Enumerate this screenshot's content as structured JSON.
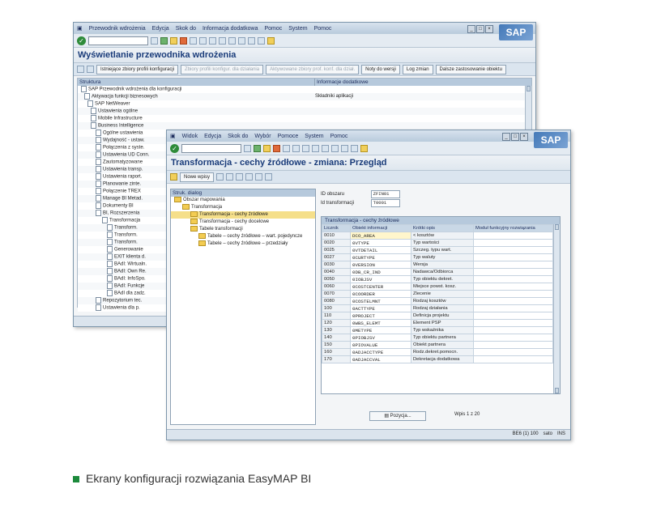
{
  "win1": {
    "menu": [
      "Przewodnik wdrożenia",
      "Edycja",
      "Skok do",
      "Informacja dodatkowa",
      "Pomoc",
      "System",
      "Pomoc"
    ],
    "title": "Wyświetlanie przewodnika wdrożenia",
    "buttons": [
      {
        "label": "Istniejące zbiory profili konfiguracji",
        "enabled": true
      },
      {
        "label": "Zbiory profili konfigur. dla działania",
        "enabled": false
      },
      {
        "label": "Aktywowane zbiory prof. konf. dla dział.",
        "enabled": false
      },
      {
        "label": "Noty do wersji",
        "enabled": true
      },
      {
        "label": "Log zmian",
        "enabled": true
      },
      {
        "label": "Dalsze zastosowanie obiektu",
        "enabled": true
      }
    ],
    "columns": [
      "Struktura",
      "Informacje dodatkowe"
    ],
    "tree": [
      {
        "label": "SAP Przewodnik wdrożenia dla konfiguracji",
        "info": ""
      },
      {
        "label": "Aktywacja funkcji biznesowych",
        "info": "Składniki aplikacji"
      },
      {
        "label": "SAP NetWeaver",
        "info": ""
      },
      {
        "label": "Ustawienia ogólne",
        "info": ""
      },
      {
        "label": "Mobile Infrastructure",
        "info": ""
      },
      {
        "label": "Business Intelligence",
        "info": ""
      },
      {
        "label": "Ogólne ustawienia",
        "info": ""
      },
      {
        "label": "Wydajność - ustaw.",
        "info": ""
      },
      {
        "label": "Połączenia z syste.",
        "info": ""
      },
      {
        "label": "Ustawienia UD Conn.",
        "info": ""
      },
      {
        "label": "Zautomatyzowane",
        "info": ""
      },
      {
        "label": "Ustawienia transp.",
        "info": ""
      },
      {
        "label": "Ustawienia raport.",
        "info": ""
      },
      {
        "label": "Planowanie zinte.",
        "info": ""
      },
      {
        "label": "Połączenie TREX",
        "info": ""
      },
      {
        "label": "Manage BI Metad.",
        "info": ""
      },
      {
        "label": "Dokumenty BI",
        "info": ""
      },
      {
        "label": "BI, Rozszerzenia",
        "info": ""
      },
      {
        "label": "Transformacja",
        "info": ""
      },
      {
        "label": "Transform.",
        "info": ""
      },
      {
        "label": "Transform.",
        "info": ""
      },
      {
        "label": "Transform.",
        "info": ""
      },
      {
        "label": "Generowanie",
        "info": ""
      },
      {
        "label": "EXIT klienta d.",
        "info": ""
      },
      {
        "label": "BAdI: Wirtualn.",
        "info": ""
      },
      {
        "label": "BAdI: Own Re.",
        "info": ""
      },
      {
        "label": "BAdI: InfoSpo.",
        "info": ""
      },
      {
        "label": "BAdI: Funkcje",
        "info": ""
      },
      {
        "label": "BAdI dla zadz.",
        "info": ""
      },
      {
        "label": "Repozytorium tec.",
        "info": ""
      },
      {
        "label": "Ustawienia dla p.",
        "info": ""
      }
    ]
  },
  "win2": {
    "menu": [
      "Widok",
      "Edycja",
      "Skok do",
      "Wybór",
      "Pomoce",
      "System",
      "Pomoc"
    ],
    "title": "Transformacja - cechy źródłowe - zmiana: Przegląd",
    "new_entries": "Nowe wpisy",
    "dialog_header": "Struk. dialog",
    "dialog_tree": [
      {
        "label": "Obszar mapowania",
        "level": 0
      },
      {
        "label": "Transformacja",
        "level": 1
      },
      {
        "label": "Transformacja - cechy źródłowe",
        "level": 2,
        "selected": true
      },
      {
        "label": "Transformacja - cechy docelowe",
        "level": 2
      },
      {
        "label": "Tabele transformacji",
        "level": 2
      },
      {
        "label": "Tabele – cechy źródłowe – wart. pojedyncze",
        "level": 3
      },
      {
        "label": "Tabele – cechy źródłowe – przedziały",
        "level": 3
      }
    ],
    "id_area_label": "ID obszaru",
    "id_area_value": "ZFIN01",
    "id_transform_label": "Id transformacji",
    "id_transform_value": "T0001",
    "table_title": "Transformacja - cechy źródłowe",
    "columns": [
      "Licznik",
      "Obiekt informacji",
      "Krótki opis",
      "Moduł funkcyjny rozwiązania"
    ],
    "rows": [
      [
        "0010",
        "DCO_AREA",
        "< kosztów"
      ],
      [
        "0020",
        "0VTYPE",
        "Typ wartości"
      ],
      [
        "0025",
        "0VTDETAIL",
        "Szczeg. typu wart."
      ],
      [
        "0027",
        "0CURTYPE",
        "Typ waluty"
      ],
      [
        "0030",
        "0VERSION",
        "Wersja"
      ],
      [
        "0040",
        "0DB_CR_IND",
        "Nadawca/Odbiorca"
      ],
      [
        "0050",
        "0IOBJSV",
        "Typ obiektu dekret."
      ],
      [
        "0060",
        "0COSTCENTER",
        "Miejsce powst. kosz."
      ],
      [
        "0070",
        "0COORDER",
        "Zlecenie"
      ],
      [
        "0080",
        "0COSTELMNT",
        "Rodzaj kosztów"
      ],
      [
        "100",
        "0ACTTYPE",
        "Rodzaj działania"
      ],
      [
        "110",
        "0PROJECT",
        "Definicja projektu"
      ],
      [
        "120",
        "0WBS_ELEMT",
        "Element PSP"
      ],
      [
        "130",
        "0METYPE",
        "Typ wskaźnika"
      ],
      [
        "140",
        "0PIOBJSV",
        "Typ obiektu partnera"
      ],
      [
        "150",
        "0PIOVALUE",
        "Obiekt partnera"
      ],
      [
        "160",
        "0ADJACCTYPE",
        "Rodz.dekret.pomocn."
      ],
      [
        "170",
        "0ADJACCVAL",
        "Dekretacja dodatkowa"
      ]
    ],
    "position_button": "Pozycja...",
    "entry_info": "Wpis 1 z 20",
    "status": "BE6 (1) 100",
    "status_host": "sato",
    "status_mode": "INS"
  },
  "caption": "Ekrany konfiguracji rozwiązania EasyMAP BI",
  "colors": {
    "caption_bullet": "#1c8a3c",
    "title": "#1a3c7a",
    "selected_row": "#f5df8a"
  }
}
